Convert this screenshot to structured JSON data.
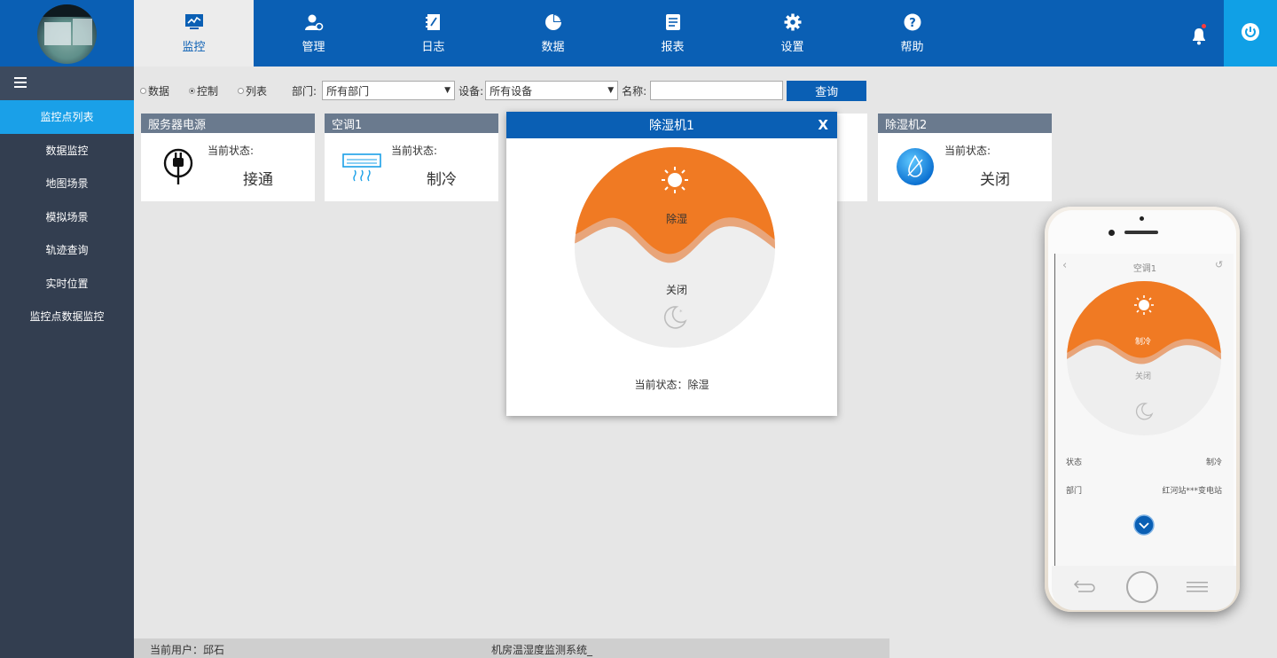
{
  "nav": {
    "items": [
      {
        "label": "监控",
        "icon": "monitor-chart-icon",
        "active": true
      },
      {
        "label": "管理",
        "icon": "user-gear-icon"
      },
      {
        "label": "日志",
        "icon": "notebook-icon"
      },
      {
        "label": "数据",
        "icon": "pie-chart-icon"
      },
      {
        "label": "报表",
        "icon": "report-icon"
      },
      {
        "label": "设置",
        "icon": "gear-icon"
      },
      {
        "label": "帮助",
        "icon": "help-icon"
      }
    ]
  },
  "sidebar": {
    "items": [
      {
        "label": "监控点列表",
        "active": true
      },
      {
        "label": "数据监控"
      },
      {
        "label": "地图场景"
      },
      {
        "label": "模拟场景"
      },
      {
        "label": "轨迹查询"
      },
      {
        "label": "实时位置"
      },
      {
        "label": "监控点数据监控"
      }
    ]
  },
  "filters": {
    "radio_data": "数据",
    "radio_control": "控制",
    "radio_list": "列表",
    "dept_label": "部门:",
    "dept_value": "所有部门",
    "device_label": "设备:",
    "device_value": "所有设备",
    "name_label": "名称:",
    "name_value": "",
    "query_label": "查询"
  },
  "cards": [
    {
      "title": "服务器电源",
      "label": "当前状态:",
      "status": "接通",
      "icon": "power-plug-icon"
    },
    {
      "title": "空调1",
      "label": "当前状态:",
      "status": "制冷",
      "icon": "air-conditioner-icon"
    },
    {
      "title": "除湿机2",
      "label": "当前状态:",
      "status": "关闭",
      "icon": "water-drop-icon"
    }
  ],
  "modal": {
    "title": "除湿机1",
    "close": "X",
    "top_label": "除湿",
    "bottom_label": "关闭",
    "status_text": "当前状态：除湿",
    "colors": {
      "active": "#f07a23",
      "wave": "#e8a57a",
      "inactive": "#eeeeee"
    }
  },
  "phone": {
    "title": "空调1",
    "top_label": "制冷",
    "bottom_label": "关闭",
    "rows": [
      {
        "key": "状态",
        "value": "制冷"
      },
      {
        "key": "部门",
        "value": "红河站***变电站"
      }
    ]
  },
  "footer": {
    "user": "当前用户：邱石",
    "system": "机房温湿度监测系统_"
  },
  "colors": {
    "primary": "#0a5fb4",
    "sidebar": "#333e50",
    "sidebar_active": "#1aa0e8",
    "card_header": "#6a7a8e",
    "accent_orange": "#f07a23"
  }
}
